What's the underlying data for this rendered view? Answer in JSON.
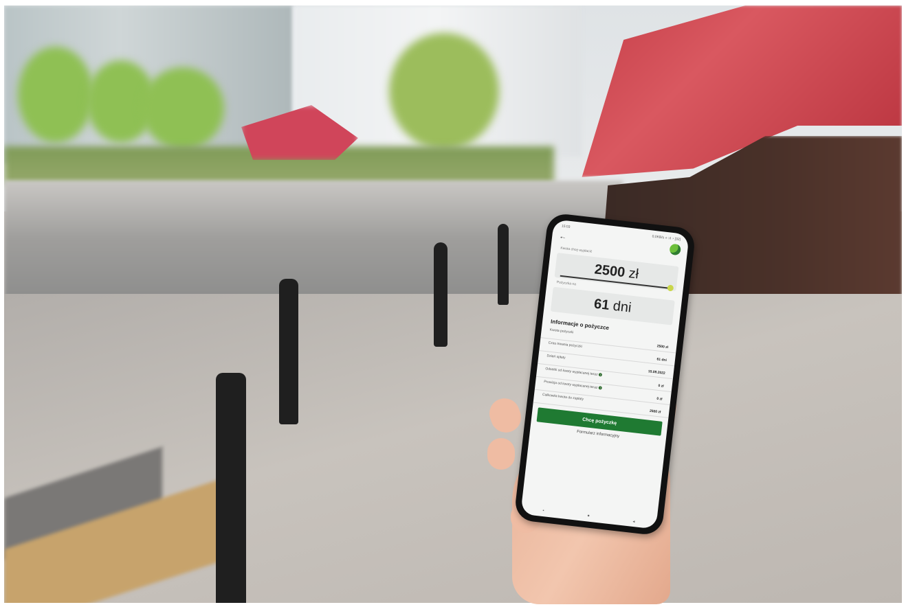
{
  "status_bar": {
    "time": "15:03",
    "right": "0,0KB/s ⟡ ⫶ıl ◔ [32]"
  },
  "app": {
    "amount_label": "Kwota chcę wypłacić",
    "amount_value": "2500",
    "amount_unit": "zł",
    "period_label": "Pożyczka na",
    "period_value": "61",
    "period_unit": "dni",
    "info_title": "Informacje o pożyczce",
    "rows": [
      {
        "k": "Kwota pożyczki",
        "v": "2500 zł"
      },
      {
        "k": "Czas trwania pożyczki",
        "v": "61 dni"
      },
      {
        "k": "Dzień spłaty",
        "v": "15.09.2022"
      },
      {
        "k": "Odsetki od kwoty wypłacanej teraz",
        "v": "0 zł"
      },
      {
        "k": "Prowizja od kwoty wypłacanej teraz",
        "v": "0 zł"
      },
      {
        "k": "Całkowita kwota do zapłaty",
        "v": "2500 zł"
      }
    ],
    "cta_label": "Chcę pożyczkę",
    "link_label": "Formularz informacyjny"
  },
  "icons": {
    "back": "arrow-left-icon",
    "logo": "brand-logo-icon",
    "nav_menu": "menu-icon",
    "nav_home": "home-icon",
    "nav_back": "triangle-back-icon"
  },
  "colors": {
    "primary_green": "#1f7a32",
    "screen_bg": "#f4f5f4",
    "accent_red": "#c23b45"
  }
}
